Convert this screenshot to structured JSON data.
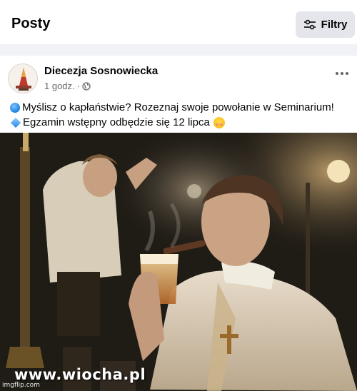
{
  "header": {
    "title": "Posty",
    "filter_label": "Filtry",
    "filter_icon": "sliders-icon"
  },
  "post": {
    "author": "Diecezja Sosnowiecka",
    "time": "1 godz.",
    "separator": "·",
    "privacy_icon": "globe-icon",
    "more_icon": "more-horizontal-icon",
    "line1": "Myślisz o kapłaństwie? Rozeznaj swoje powołanie w Seminarium!",
    "line2": "Egzamin wstępny odbędzie się 12 lipca",
    "line1_emoji": "blue-circle",
    "line2_emoji": "small-blue-diamond",
    "line2_end_emoji": "relieved-face"
  },
  "image": {
    "watermark": "www.wiocha.pl",
    "credit": "imgflip.com"
  },
  "colors": {
    "page_bg": "#f0f2f5",
    "card_bg": "#ffffff",
    "button_bg": "#e4e6eb",
    "secondary_text": "#65676b"
  }
}
